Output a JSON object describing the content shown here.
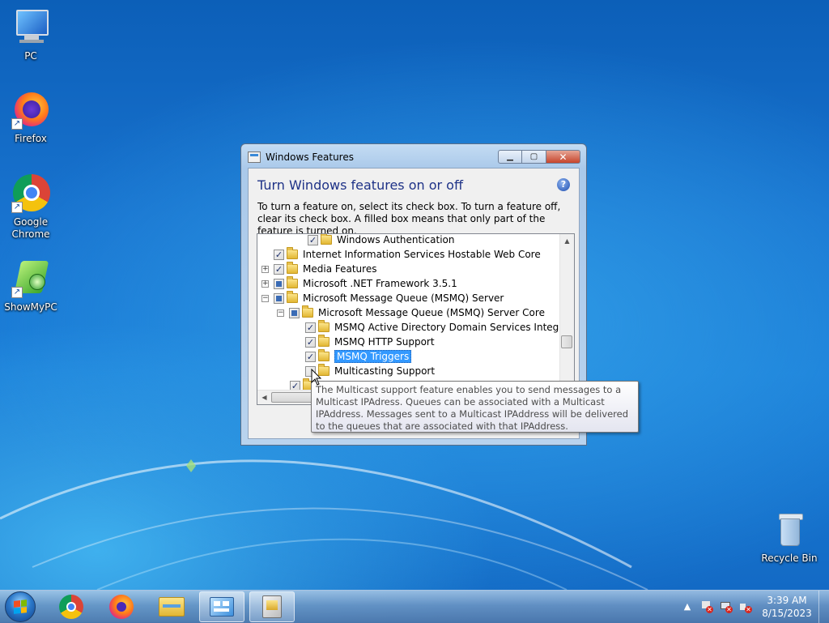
{
  "desktop": {
    "icons": [
      {
        "label": "PC",
        "icon": "computer-icon"
      },
      {
        "label": "Firefox",
        "icon": "firefox-icon"
      },
      {
        "label": "Google Chrome",
        "icon": "chrome-icon"
      },
      {
        "label": "ShowMyPC",
        "icon": "showmypc-icon"
      },
      {
        "label": "Recycle Bin",
        "icon": "recycle-bin-icon"
      }
    ]
  },
  "window": {
    "title": "Windows Features",
    "heading": "Turn Windows features on or off",
    "description": "To turn a feature on, select its check box. To turn a feature off, clear its check box. A filled box means that only part of the feature is turned on.",
    "help_symbol": "?",
    "tree": [
      {
        "label": "Windows Authentication",
        "state": "checked",
        "expander": "none",
        "selected": false
      },
      {
        "label": "Internet Information Services Hostable Web Core",
        "state": "checked",
        "expander": "none",
        "selected": false
      },
      {
        "label": "Media Features",
        "state": "checked",
        "expander": "+",
        "selected": false
      },
      {
        "label": "Microsoft .NET Framework 3.5.1",
        "state": "partial",
        "expander": "+",
        "selected": false
      },
      {
        "label": "Microsoft Message Queue (MSMQ) Server",
        "state": "partial",
        "expander": "−",
        "selected": false
      },
      {
        "label": "Microsoft Message Queue (MSMQ) Server Core",
        "state": "partial",
        "expander": "−",
        "selected": false
      },
      {
        "label": "MSMQ Active Directory Domain Services Integration",
        "state": "checked",
        "expander": "none",
        "selected": false
      },
      {
        "label": "MSMQ HTTP Support",
        "state": "checked",
        "expander": "none",
        "selected": false
      },
      {
        "label": "MSMQ Triggers",
        "state": "checked",
        "expander": "none",
        "selected": true
      },
      {
        "label": "Multicasting Support",
        "state": "unchecked",
        "expander": "none",
        "selected": false
      }
    ]
  },
  "tooltip": {
    "text": "The Multicast support feature enables you to send messages to a Multicast IPAdress. Queues can be associated with a Multicast IPAddress. Messages sent to a Multicast IPAddress will be delivered to the queues that are associated with that IPAddress."
  },
  "taskbar": {
    "items": [
      "chrome-icon",
      "firefox-icon",
      "file-explorer-icon",
      "control-panel-icon",
      "windows-features-icon"
    ],
    "clock_time": "3:39 AM",
    "clock_date": "8/15/2023"
  },
  "colors": {
    "selection": "#3399ff",
    "heading": "#1e3287",
    "close_button": "#c7442b"
  }
}
